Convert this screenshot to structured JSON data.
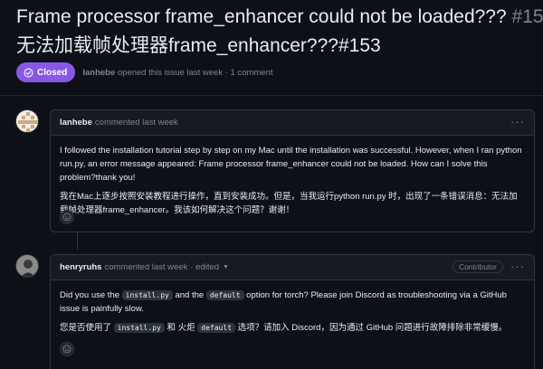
{
  "issue": {
    "title_en": "Frame processor frame_enhancer could not be loaded???",
    "number": "#153",
    "title_zh": "无法加载帧处理器frame_enhancer???#153",
    "state": "Closed",
    "author": "lanhebe",
    "meta_rest": "opened this issue last week · 1 comment"
  },
  "comments": [
    {
      "author": "lanhebe",
      "time": "commented last week",
      "body_en": "I followed the installation tutorial step by step on my Mac until the installation was successful. However, when I ran python run.py, an error message appeared: Frame processor frame_enhancer could not be loaded. How can I solve this problem?thank you!",
      "body_zh": "我在Mac上逐步按照安装教程进行操作，直到安装成功。但是，当我运行python run.py 时，出现了一条错误消息：无法加载帧处理器frame_enhancer。我该如何解决这个问题？谢谢！"
    },
    {
      "author": "henryruhs",
      "time": "commented last week",
      "edited": "· edited",
      "role": "Contributor",
      "en_1": "Did you use the",
      "code_a": "install.py",
      "en_2": "and the",
      "code_b": "default",
      "en_3": "option for torch? Please join Discord as troubleshooting via a GitHub issue is painfully slow.",
      "zh_1": "您是否使用了",
      "zh_code_a": "install.py",
      "zh_2": "和 火炬",
      "zh_code_b": "default",
      "zh_3": "选项？请加入 Discord，因为通过 GitHub 问题进行故障排除非常缓慢。"
    }
  ],
  "colors": {
    "background": "#0d1117",
    "closed_badge": "#8957e5",
    "muted_text": "#7d8590",
    "border": "#30363d"
  },
  "icons": [
    "closed-check-icon",
    "kebab-menu-icon",
    "smiley-icon",
    "chevron-down-icon"
  ]
}
